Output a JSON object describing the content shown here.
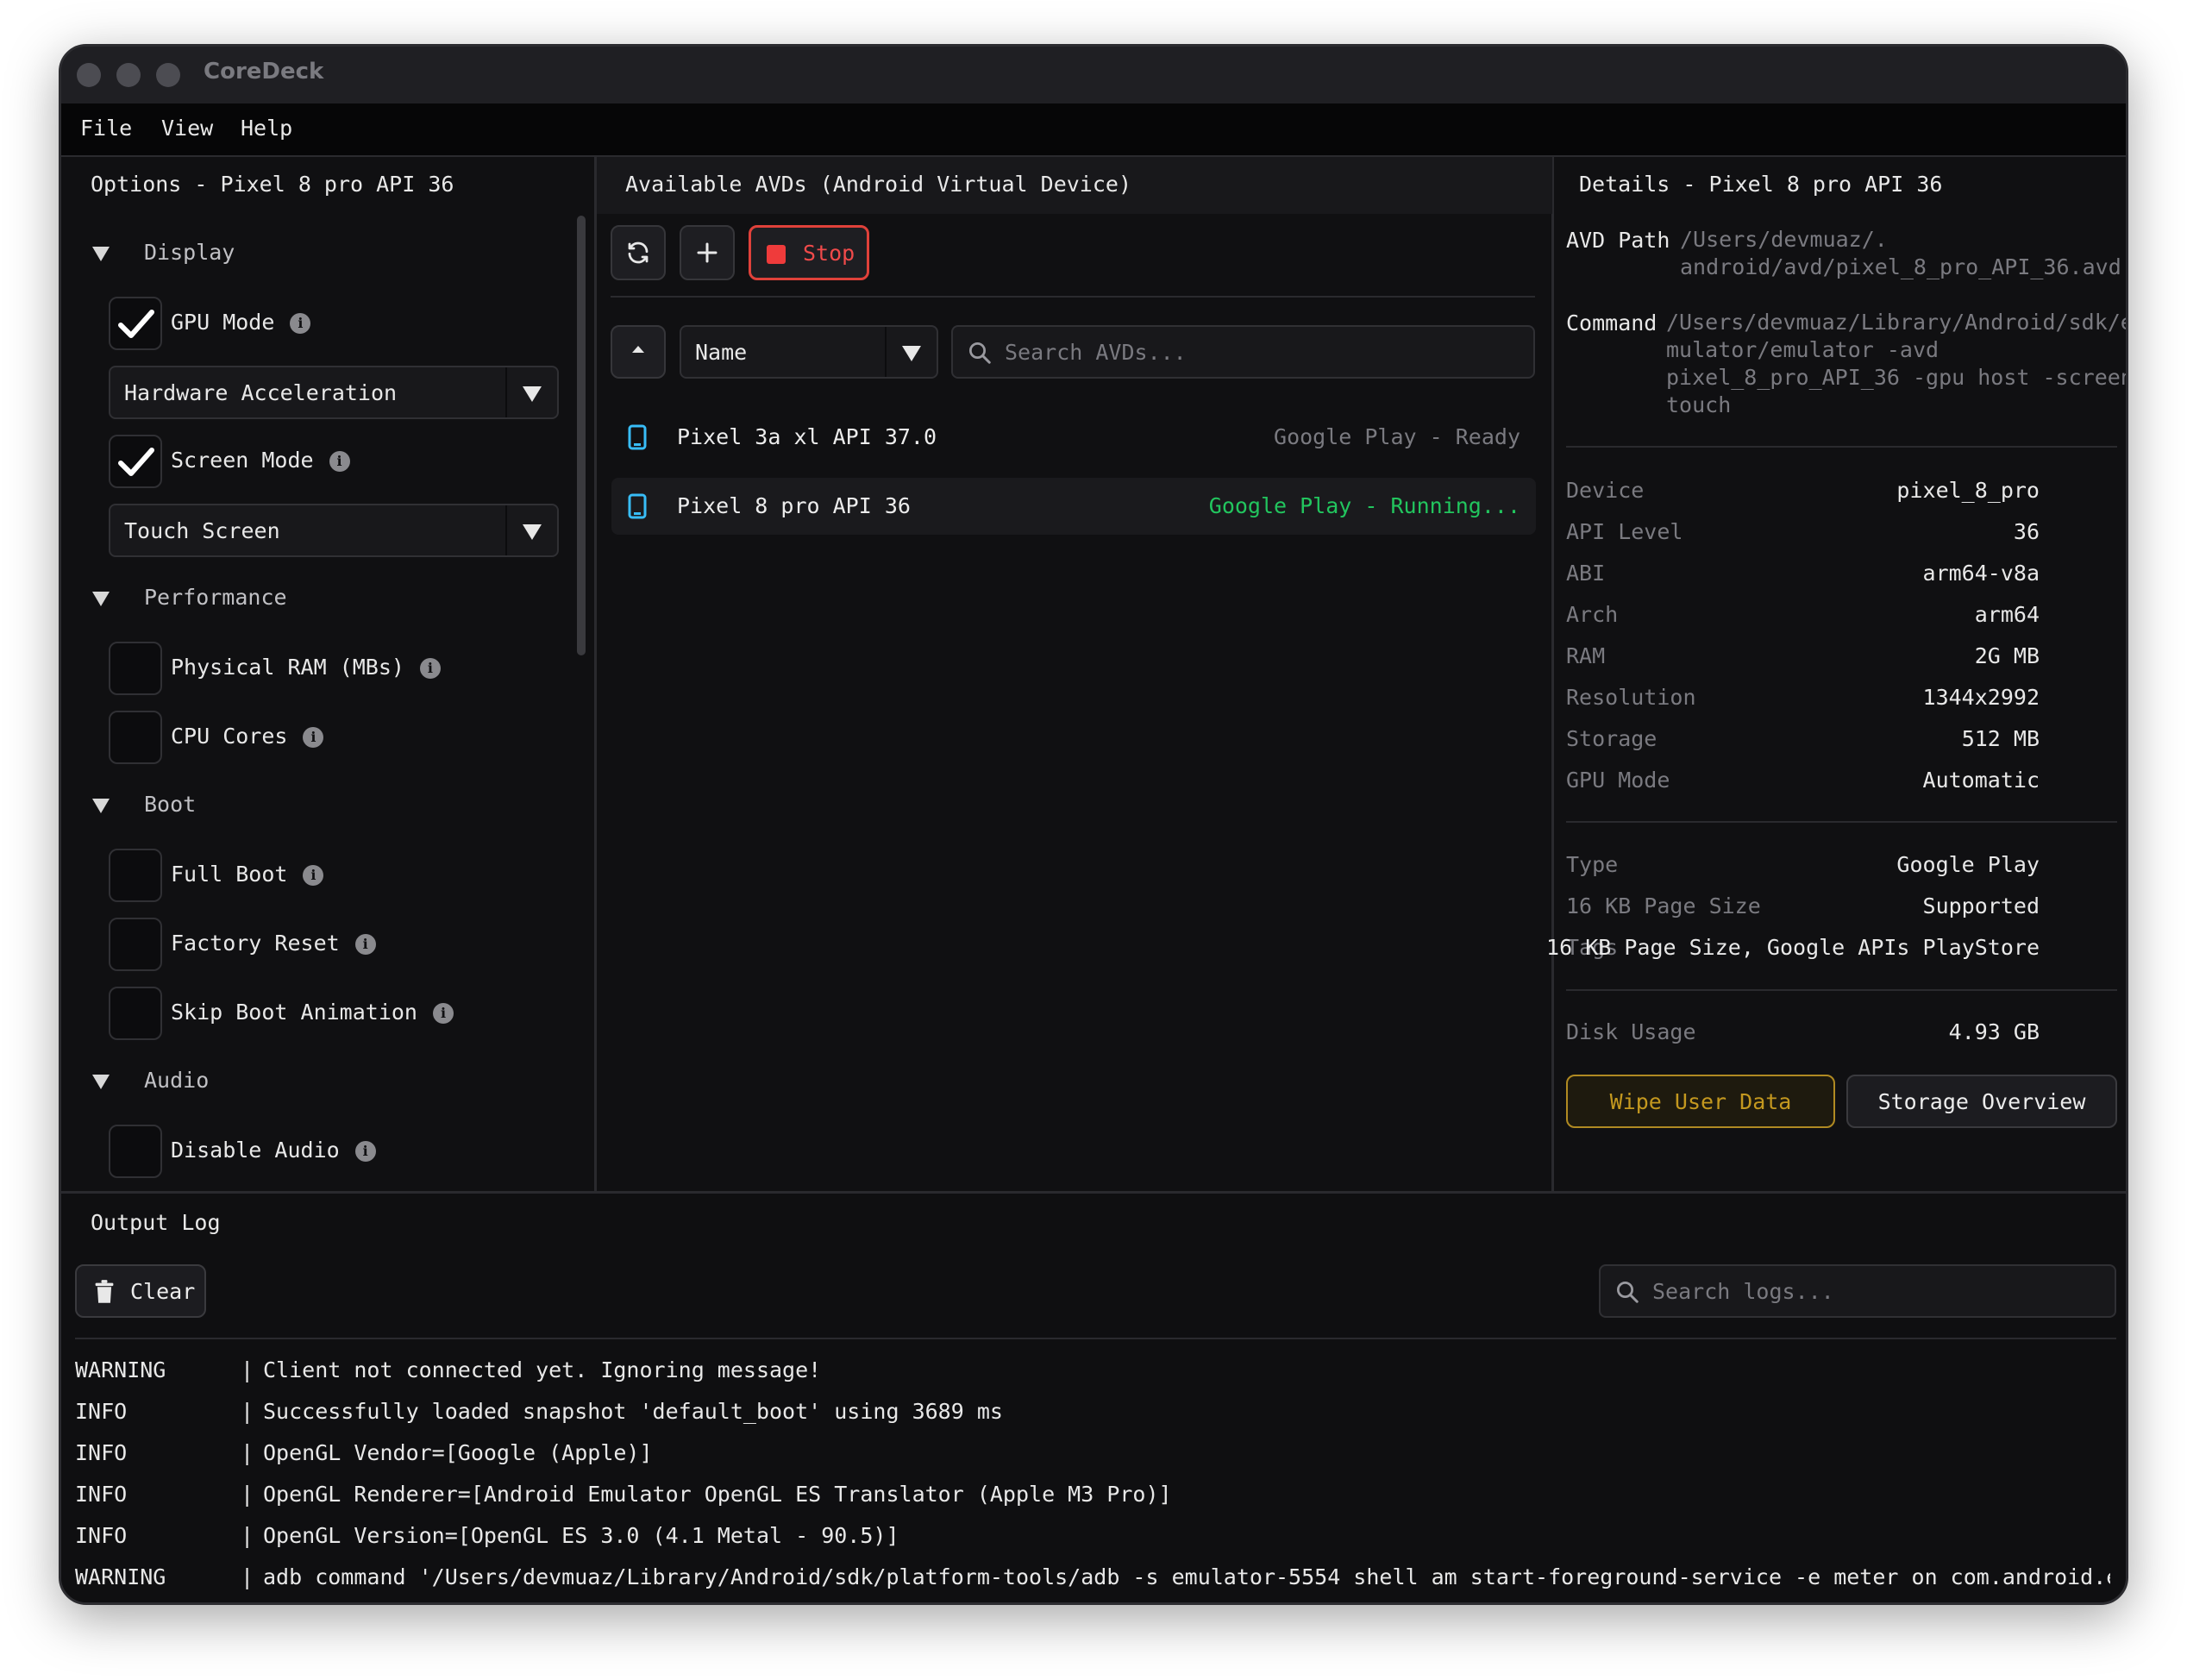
{
  "window": {
    "title": "CoreDeck"
  },
  "menu": {
    "file": "File",
    "view": "View",
    "help": "Help"
  },
  "options": {
    "title": "Options - Pixel 8 pro API 36",
    "sections": {
      "display": "Display",
      "performance": "Performance",
      "boot": "Boot",
      "audio": "Audio"
    },
    "gpu_mode": {
      "label": "GPU Mode",
      "checked": true,
      "value": "Hardware Acceleration"
    },
    "screen_mode": {
      "label": "Screen Mode",
      "checked": true,
      "value": "Touch Screen"
    },
    "physical_ram": {
      "label": "Physical RAM (MBs)",
      "checked": false
    },
    "cpu_cores": {
      "label": "CPU Cores",
      "checked": false
    },
    "full_boot": {
      "label": "Full Boot",
      "checked": false
    },
    "factory_reset": {
      "label": "Factory Reset",
      "checked": false
    },
    "skip_boot_animation": {
      "label": "Skip Boot Animation",
      "checked": false
    },
    "disable_audio": {
      "label": "Disable Audio",
      "checked": false
    }
  },
  "avds": {
    "title": "Available AVDs (Android Virtual Device)",
    "stop_label": "Stop",
    "sort_field": "Name",
    "search_placeholder": "Search AVDs...",
    "list": [
      {
        "name": "Pixel 3a xl API 37.0",
        "status": "Google Play - Ready"
      },
      {
        "name": "Pixel 8 pro API 36",
        "status": "Google Play - Running..."
      }
    ]
  },
  "details": {
    "title": "Details - Pixel 8 pro API 36",
    "avd_path_label": "AVD Path",
    "avd_path_line1": "/Users/devmuaz/.",
    "avd_path_line2": "android/avd/pixel_8_pro_API_36.avd",
    "command_label": "Command",
    "command_line1": "/Users/devmuaz/Library/Android/sdk/e",
    "command_line2": "mulator/emulator -avd",
    "command_line3": "pixel_8_pro_API_36 -gpu host -screen",
    "command_line4": "touch",
    "props": [
      {
        "key": "Device",
        "value": "pixel_8_pro"
      },
      {
        "key": "API Level",
        "value": "36"
      },
      {
        "key": "ABI",
        "value": "arm64-v8a"
      },
      {
        "key": "Arch",
        "value": "arm64"
      },
      {
        "key": "RAM",
        "value": "2G MB"
      },
      {
        "key": "Resolution",
        "value": "1344x2992"
      },
      {
        "key": "Storage",
        "value": "512 MB"
      },
      {
        "key": "GPU Mode",
        "value": "Automatic"
      }
    ],
    "type_key": "Type",
    "type_value": "Google Play",
    "page_size_key": "16 KB Page Size",
    "page_size_value": "Supported",
    "tags_key": "Tags",
    "tags_value": "16 KB Page Size, Google APIs PlayStore",
    "disk_usage_key": "Disk Usage",
    "disk_usage_value": "4.93 GB",
    "wipe_label": "Wipe User Data",
    "storage_label": "Storage Overview"
  },
  "log": {
    "title": "Output Log",
    "clear_label": "Clear",
    "search_placeholder": "Search logs...",
    "separator": "|",
    "lines": [
      {
        "level": "WARNING",
        "message": "Client not connected yet. Ignoring message!"
      },
      {
        "level": "INFO",
        "message": "Successfully loaded snapshot 'default_boot' using 3689 ms"
      },
      {
        "level": "INFO",
        "message": "OpenGL Vendor=[Google (Apple)]"
      },
      {
        "level": "INFO",
        "message": "OpenGL Renderer=[Android Emulator OpenGL ES Translator (Apple M3 Pro)]"
      },
      {
        "level": "INFO",
        "message": "OpenGL Version=[OpenGL ES 3.0 (4.1 Metal - 90.5)]"
      },
      {
        "level": "WARNING",
        "message": "adb command '/Users/devmuaz/Library/Android/sdk/platform-tools/adb -s emulator-5554 shell am start-foreground-service -e meter on com.android.emulator"
      }
    ]
  },
  "colors": {
    "running": "#22c55e",
    "ready": "#7a7a80",
    "stop": "#ef3b3b",
    "wipe": "#c4981f",
    "device_icon": "#38bdf8"
  }
}
